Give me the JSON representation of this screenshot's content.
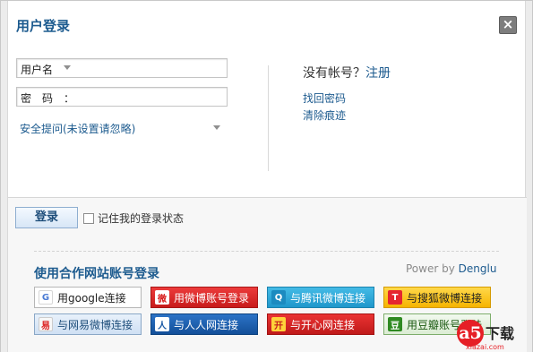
{
  "dialog": {
    "title": "用户登录",
    "close_label": "×"
  },
  "form": {
    "username_label": "用户名",
    "password_label": "密　码　：",
    "security_question": "安全提问(未设置请忽略)"
  },
  "side": {
    "no_account_text": "没有帐号？",
    "register_label": "注册",
    "find_password": "找回密码",
    "clear_traces": "清除痕迹"
  },
  "actions": {
    "login_label": "登录",
    "remember_label": "记住我的登录状态"
  },
  "partners": {
    "title": "使用合作网站账号登录",
    "powered_by": "Power by ",
    "powered_brand": "Denglu",
    "items": [
      {
        "label": "用google连接",
        "icon": "google-icon",
        "glyph": "G"
      },
      {
        "label": "用微博账号登录",
        "icon": "weibo-icon",
        "glyph": "微"
      },
      {
        "label": "与腾讯微博连接",
        "icon": "tencent-weibo-icon",
        "glyph": "Q"
      },
      {
        "label": "与搜狐微博连接",
        "icon": "sohu-weibo-icon",
        "glyph": "T"
      },
      {
        "label": "与网易微博连接",
        "icon": "netease-weibo-icon",
        "glyph": "易"
      },
      {
        "label": "与人人网连接",
        "icon": "renren-icon",
        "glyph": "人"
      },
      {
        "label": "与开心网连接",
        "icon": "kaixin-icon",
        "glyph": "开"
      },
      {
        "label": "用豆瓣账号登陆",
        "icon": "douban-icon",
        "glyph": "豆"
      }
    ]
  },
  "watermark": {
    "mark": "a5",
    "text": "下载",
    "site": "xiazai.com"
  }
}
